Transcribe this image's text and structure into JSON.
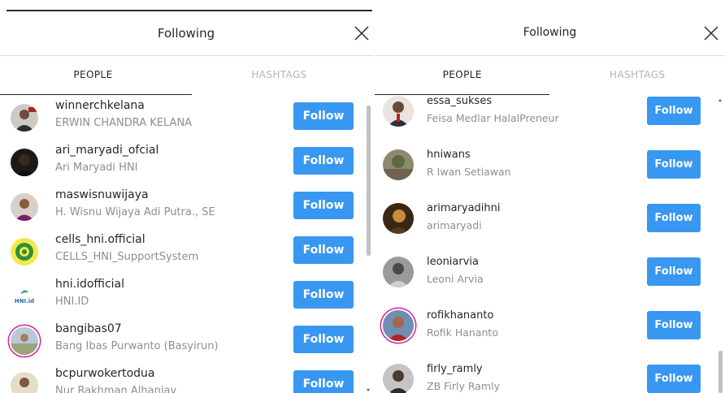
{
  "panels": [
    {
      "title": "Following",
      "tabs": {
        "people": "PEOPLE",
        "hashtags": "HASHTAGS"
      },
      "follow_label": "Follow",
      "users": [
        {
          "username": "winnerchkelana",
          "fullname": "ERWIN CHANDRA KELANA"
        },
        {
          "username": "ari_maryadi_ofcial",
          "fullname": "Ari Maryadi HNI"
        },
        {
          "username": "maswisnuwijaya",
          "fullname": "H. Wisnu Wijaya Adi Putra., SE"
        },
        {
          "username": "cells_hni.official",
          "fullname": "CELLS_HNI_SupportSystem"
        },
        {
          "username": "hni.idofficial",
          "fullname": "HNI.ID",
          "avatar_text": "HNI.id"
        },
        {
          "username": "bangibas07",
          "fullname": "Bang Ibas Purwanto (Basyirun)"
        },
        {
          "username": "bcpurwokertodua",
          "fullname": "Nur Rakhman Alhaniav"
        }
      ]
    },
    {
      "title": "Following",
      "tabs": {
        "people": "PEOPLE",
        "hashtags": "HASHTAGS"
      },
      "follow_label": "Follow",
      "users": [
        {
          "username": "essa_sukses",
          "fullname": "Feisa Medlar HalalPreneur"
        },
        {
          "username": "hniwans",
          "fullname": "R Iwan Setiawan"
        },
        {
          "username": "arimaryadihni",
          "fullname": "arimaryadi"
        },
        {
          "username": "leoniarvia",
          "fullname": "Leoni Arvia"
        },
        {
          "username": "rofikhananto",
          "fullname": "Rofik Hananto"
        },
        {
          "username": "firly_ramly",
          "fullname": "ZB Firly Ramly"
        }
      ]
    }
  ],
  "colors": {
    "follow_button": "#3897f0",
    "story_ring": "#d6249f",
    "muted_text": "#8e8e8e"
  },
  "icons": {
    "close": "close-x-icon"
  }
}
